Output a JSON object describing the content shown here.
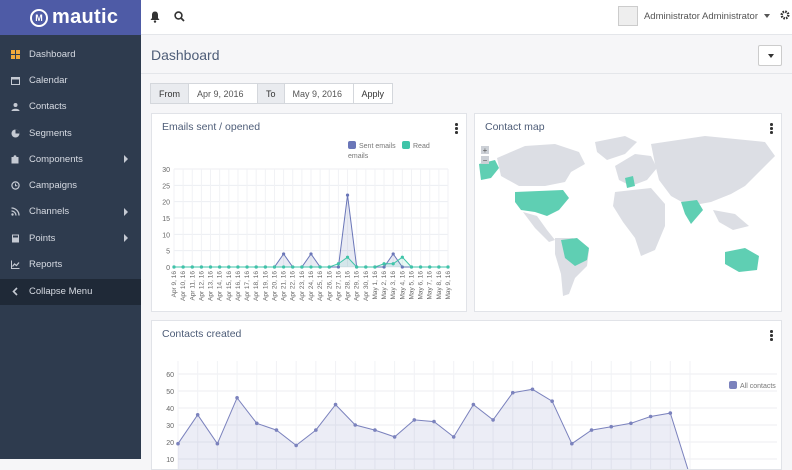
{
  "brand": {
    "name": "mautic",
    "mark": "M"
  },
  "topbar": {
    "user": "Administrator Administrator"
  },
  "sidebar": {
    "items": [
      {
        "label": "Dashboard",
        "icon": "dashboard-icon"
      },
      {
        "label": "Calendar",
        "icon": "calendar-icon"
      },
      {
        "label": "Contacts",
        "icon": "user-icon"
      },
      {
        "label": "Segments",
        "icon": "pie-icon"
      },
      {
        "label": "Components",
        "icon": "puzzle-icon"
      },
      {
        "label": "Campaigns",
        "icon": "clock-icon"
      },
      {
        "label": "Channels",
        "icon": "rss-icon"
      },
      {
        "label": "Points",
        "icon": "calculator-icon"
      },
      {
        "label": "Reports",
        "icon": "line-chart-icon"
      },
      {
        "label": "Collapse Menu",
        "icon": "chevron-left-icon"
      }
    ]
  },
  "page": {
    "title": "Dashboard"
  },
  "filter": {
    "from_label": "From",
    "from_value": "Apr 9, 2016",
    "to_label": "To",
    "to_value": "May 9, 2016",
    "apply": "Apply"
  },
  "panels": {
    "emails": "Emails sent / opened",
    "map": "Contact map",
    "contacts": "Contacts created"
  },
  "colors": {
    "sent": "#6a76b8",
    "read": "#3fc4a8",
    "contacts": "#7b82bd",
    "map_highlight": "#5fcfb3",
    "map_land": "#dcdee4"
  },
  "chart_data": [
    {
      "type": "line",
      "title": "Emails sent / opened",
      "ylim": [
        0,
        30
      ],
      "yticks": [
        0,
        5,
        10,
        15,
        20,
        25,
        30
      ],
      "categories": [
        "Apr 9, 16",
        "Apr 10, 16",
        "Apr 11, 16",
        "Apr 12, 16",
        "Apr 13, 16",
        "Apr 14, 16",
        "Apr 15, 16",
        "Apr 16, 16",
        "Apr 17, 16",
        "Apr 18, 16",
        "Apr 19, 16",
        "Apr 20, 16",
        "Apr 21, 16",
        "Apr 22, 16",
        "Apr 23, 16",
        "Apr 24, 16",
        "Apr 25, 16",
        "Apr 26, 16",
        "Apr 27, 16",
        "Apr 28, 16",
        "Apr 29, 16",
        "Apr 30, 16",
        "May 1, 16",
        "May 2, 16",
        "May 3, 16",
        "May 4, 16",
        "May 5, 16",
        "May 6, 16",
        "May 7, 16",
        "May 8, 16",
        "May 9, 16"
      ],
      "series": [
        {
          "name": "Sent emails",
          "values": [
            0,
            0,
            0,
            0,
            0,
            0,
            0,
            0,
            0,
            0,
            0,
            0,
            4,
            0,
            0,
            4,
            0,
            0,
            0,
            22,
            0,
            0,
            0,
            0,
            4,
            0,
            0,
            0,
            0,
            0,
            0
          ]
        },
        {
          "name": "Read emails",
          "values": [
            0,
            0,
            0,
            0,
            0,
            0,
            0,
            0,
            0,
            0,
            0,
            0,
            0,
            0,
            0,
            0,
            0,
            0,
            1,
            3,
            0,
            0,
            0,
            1,
            1,
            3,
            0,
            0,
            0,
            0,
            0
          ]
        }
      ],
      "legend": "top-right"
    },
    {
      "type": "area",
      "title": "Contacts created",
      "ylim": [
        0,
        60
      ],
      "yticks": [
        10,
        20,
        30,
        40,
        50,
        60
      ],
      "series": [
        {
          "name": "All contacts",
          "values": [
            19,
            36,
            19,
            46,
            31,
            27,
            18,
            27,
            42,
            30,
            27,
            23,
            33,
            32,
            23,
            42,
            33,
            49,
            51,
            44,
            19,
            27,
            29,
            31,
            35,
            37,
            0
          ]
        }
      ],
      "legend": "top-right"
    }
  ]
}
